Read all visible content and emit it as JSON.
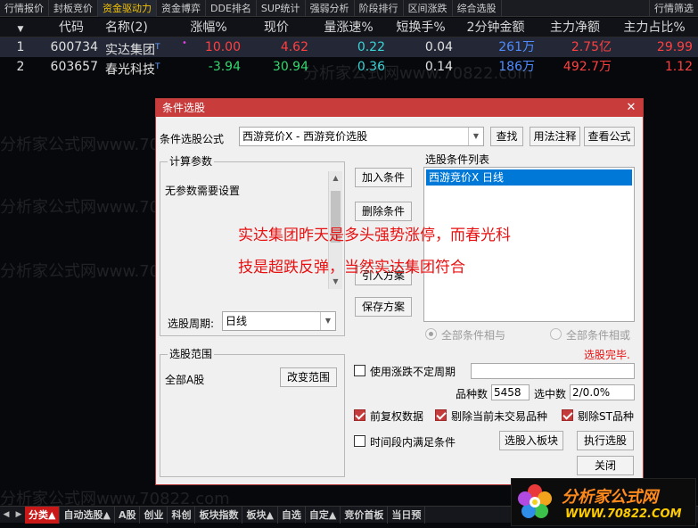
{
  "top_tabs": [
    "行情报价",
    "封板竞价",
    "资金驱动力",
    "资金博弈",
    "DDE排名",
    "SUP统计",
    "强弱分析",
    "阶段排行",
    "区间涨跌",
    "综合选股"
  ],
  "top_tab_active": "资金驱动力",
  "top_right_tab": "行情筛选",
  "table": {
    "headers": [
      "代码",
      "名称(2)",
      "涨幅%",
      "现价",
      "量涨速%",
      "短换手%",
      "2分钟金额",
      "主力净额",
      "主力占比%"
    ],
    "rows": [
      {
        "idx": "1",
        "code": "600734",
        "name": "实达集团",
        "pct": "10.00",
        "price": "4.62",
        "speed": "0.22",
        "turnover": "0.04",
        "amount": "261万",
        "net": "2.75亿",
        "ratio": "29.99"
      },
      {
        "idx": "2",
        "code": "603657",
        "name": "春光科技",
        "pct": "-3.94",
        "price": "30.94",
        "speed": "0.36",
        "turnover": "0.14",
        "amount": "186万",
        "net": "492.7万",
        "ratio": "1.12"
      }
    ]
  },
  "watermark": {
    "text_a": "分析家公式网www.70822.com",
    "text_b": "分析家公式网www.70822.com"
  },
  "dialog": {
    "title": "条件选股",
    "formula_label": "条件选股公式",
    "formula_value": "西游竞价X  -  西游竞价选股",
    "find_button": "查找",
    "usage_button": "用法注释",
    "view_button": "查看公式",
    "calc_params_title": "计算参数",
    "no_params_text": "无参数需要设置",
    "add_condition": "加入条件",
    "delete_condition": "删除条件",
    "import_plan": "引入方案",
    "save_plan": "保存方案",
    "condition_list_label": "选股条件列表",
    "condition_item": "西游竞价X  日线",
    "period_label": "选股周期:",
    "period_value": "日线",
    "range_title": "选股范围",
    "range_value": "全部A股",
    "change_range": "改变范围",
    "and_all": "全部条件相与",
    "or_all": "全部条件相或",
    "done_text": "选股完毕.",
    "use_uncertain_period": "使用涨跌不定周期",
    "count_label": "品种数",
    "count_value": "5458",
    "selected_label": "选中数",
    "selected_value": "2/0.0%",
    "pre_adjust": "前复权数据",
    "remove_no_trade": "剔除当前未交易品种",
    "remove_st": "剔除ST品种",
    "time_period_satisfy": "时间段内满足条件",
    "select_to_block": "选股入板块",
    "execute": "执行选股",
    "close": "关闭"
  },
  "annotation": {
    "line1": "实达集团昨天是多头强势涨停，而春光科",
    "line2": "技是超跌反弹，当然实达集团符合"
  },
  "bottom_tabs": [
    "分类▲",
    "自动选股▲",
    "A股",
    "创业",
    "科创",
    "板块指数",
    "板块▲",
    "自选",
    "自定▲",
    "竞价首板",
    "当日预"
  ],
  "bottom_tab_active": "分类▲",
  "logo": {
    "title": "分析家公式网",
    "url": "WWW.70822.COM"
  },
  "colors": {
    "up": "#ff4040",
    "down": "#33d66e",
    "dialog_title_bg": "#c83c3c",
    "annotation": "#e81010"
  }
}
